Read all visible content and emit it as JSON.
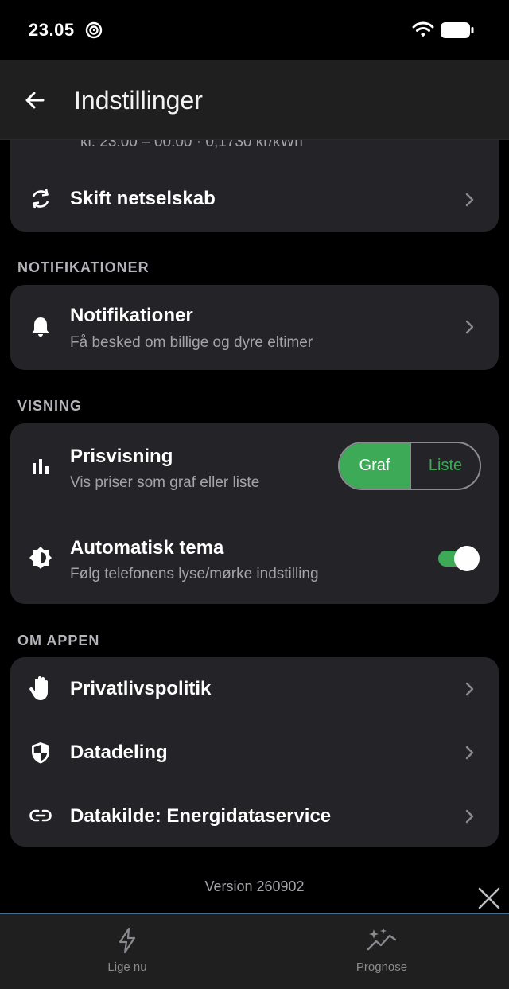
{
  "status_bar": {
    "time": "23.05"
  },
  "app_bar": {
    "title": "Indstillinger",
    "back_icon": "arrow-left-icon"
  },
  "grid_card": {
    "partial_text": "kl. 23.00 – 00.00 · 0,1730 kr/kWh",
    "change_grid_label": "Skift netselskab"
  },
  "notifications_section": {
    "title": "NOTIFIKATIONER",
    "item": {
      "label": "Notifikationer",
      "sub": "Få besked om billige og dyre eltimer"
    }
  },
  "display_section": {
    "title": "VISNING",
    "price_view": {
      "label": "Prisvisning",
      "sub": "Vis priser som graf eller liste",
      "options": [
        "Graf",
        "Liste"
      ],
      "selected": "Graf"
    },
    "auto_theme": {
      "label": "Automatisk tema",
      "sub": "Følg telefonens lyse/mørke indstilling",
      "enabled": true
    }
  },
  "about_section": {
    "title": "OM APPEN",
    "items": [
      {
        "label": "Privatlivspolitik"
      },
      {
        "label": "Datadeling"
      },
      {
        "label": "Datakilde: Energidataservice"
      }
    ]
  },
  "version": "Version 260902",
  "bottom_nav": {
    "items": [
      {
        "label": "Lige nu",
        "icon": "lightning-icon"
      },
      {
        "label": "Prognose",
        "icon": "sparkle-chart-icon"
      }
    ]
  },
  "colors": {
    "accent": "#3daa57",
    "card": "#242428",
    "bar": "#1f1f1f",
    "background": "#000000"
  }
}
